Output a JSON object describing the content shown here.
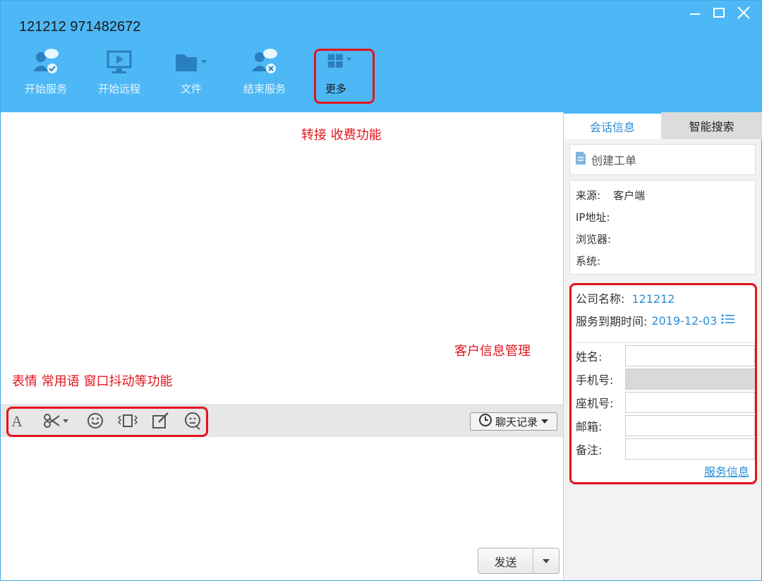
{
  "window": {
    "title": "121212 971482672"
  },
  "toolbar": {
    "items": [
      {
        "label": "开始服务",
        "icon": "start-service-icon"
      },
      {
        "label": "开始远程",
        "icon": "remote-screen-icon"
      },
      {
        "label": "文件",
        "icon": "folder-icon"
      },
      {
        "label": "结束服务",
        "icon": "end-service-icon"
      },
      {
        "label": "更多",
        "icon": "grid-icon"
      }
    ]
  },
  "annotations": {
    "more": "转接 收费功能",
    "customer": "客户信息管理",
    "tools": "表情 常用语 窗口抖动等功能"
  },
  "chat_toolbar": {
    "history_label": "聊天记录",
    "tools": [
      "font-icon",
      "scissors-icon",
      "emoji-icon",
      "shake-icon",
      "edit-icon",
      "quick-reply-icon"
    ]
  },
  "send": {
    "label": "发送"
  },
  "right_panel": {
    "tabs": [
      "会话信息",
      "智能搜索"
    ],
    "create_order": "创建工单",
    "meta": [
      {
        "label": "来源:",
        "value": "客户端"
      },
      {
        "label": "IP地址:",
        "value": ""
      },
      {
        "label": "浏览器:",
        "value": ""
      },
      {
        "label": "系统:",
        "value": ""
      }
    ],
    "company_label": "公司名称:",
    "company_value": "121212",
    "expire_label": "服务到期时间:",
    "expire_value": "2019-12-03",
    "fields": [
      {
        "label": "姓名:",
        "value": ""
      },
      {
        "label": "手机号:",
        "value": ""
      },
      {
        "label": "座机号:",
        "value": ""
      },
      {
        "label": "邮箱:",
        "value": ""
      },
      {
        "label": "备注:",
        "value": ""
      }
    ],
    "service_link": "服务信息"
  },
  "colors": {
    "header": "#4db8f5",
    "accent": "#2a8fd6",
    "annotation": "#e3141c"
  }
}
